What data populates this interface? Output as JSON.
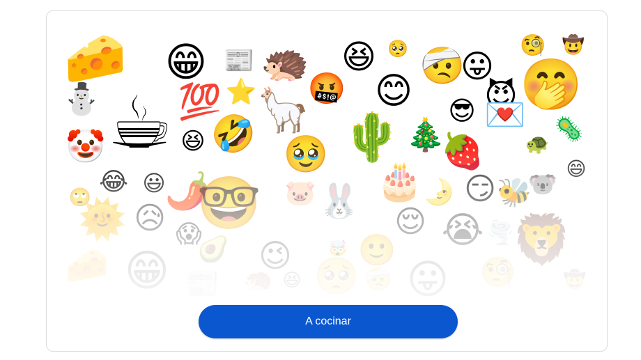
{
  "cta": {
    "label": "A cocinar",
    "color": "#0b57d0"
  },
  "emojis": [
    {
      "icon": "cheese-wedge-icon",
      "glyph": "🧀"
    },
    {
      "icon": "grinning-face-icon",
      "glyph": "😁"
    },
    {
      "icon": "newspaper-face-icon",
      "glyph": "📰"
    },
    {
      "icon": "hedgehog-icon",
      "glyph": "🦔"
    },
    {
      "icon": "laughing-face-icon",
      "glyph": "😆"
    },
    {
      "icon": "small-pleading-face-icon",
      "glyph": "🥺"
    },
    {
      "icon": "bandaged-face-icon",
      "glyph": "🤕"
    },
    {
      "icon": "tongue-face-icon",
      "glyph": "😛"
    },
    {
      "icon": "monocle-face-icon",
      "glyph": "🧐"
    },
    {
      "icon": "cowboy-face-icon",
      "glyph": "🤠"
    },
    {
      "icon": "hand-over-mouth-face-icon",
      "glyph": "🤭"
    },
    {
      "icon": "snowman-icon",
      "glyph": "⛄"
    },
    {
      "icon": "coffee-cup-icon",
      "glyph": "☕"
    },
    {
      "icon": "hundred-points-icon",
      "glyph": "💯"
    },
    {
      "icon": "star-face-icon",
      "glyph": "⭐"
    },
    {
      "icon": "llama-icon",
      "glyph": "🦙"
    },
    {
      "icon": "cursing-face-icon",
      "glyph": "🤬"
    },
    {
      "icon": "smiling-face-icon",
      "glyph": "😊"
    },
    {
      "icon": "devil-face-icon",
      "glyph": "😈"
    },
    {
      "icon": "sunglasses-face-icon",
      "glyph": "😎"
    },
    {
      "icon": "love-letter-icon",
      "glyph": "💌"
    },
    {
      "icon": "clown-face-icon",
      "glyph": "🤡"
    },
    {
      "icon": "squinting-face-icon",
      "glyph": "😆"
    },
    {
      "icon": "rolling-laughing-face-icon",
      "glyph": "🤣"
    },
    {
      "icon": "crying-face-icon",
      "glyph": "🥹"
    },
    {
      "icon": "cactus-icon",
      "glyph": "🌵"
    },
    {
      "icon": "christmas-tree-icon",
      "glyph": "🎄"
    },
    {
      "icon": "strawberry-icon",
      "glyph": "🍓"
    },
    {
      "icon": "turtle-icon",
      "glyph": "🐢"
    },
    {
      "icon": "microbe-icon",
      "glyph": "🦠"
    },
    {
      "icon": "tears-of-joy-face-icon",
      "glyph": "😂"
    },
    {
      "icon": "grinning-face-big-icon",
      "glyph": "😃"
    },
    {
      "icon": "hot-pepper-icon",
      "glyph": "🌶️"
    },
    {
      "icon": "glasses-face-icon",
      "glyph": "🤓"
    },
    {
      "icon": "birthday-cake-icon",
      "glyph": "🎂"
    },
    {
      "icon": "moon-face-icon",
      "glyph": "🌛"
    },
    {
      "icon": "smirk-face-icon",
      "glyph": "😏"
    },
    {
      "icon": "bee-icon",
      "glyph": "🐝"
    },
    {
      "icon": "koala-icon",
      "glyph": "🐨"
    },
    {
      "icon": "beaming-face-icon",
      "glyph": "😄"
    },
    {
      "icon": "rolling-eyes-face-icon",
      "glyph": "🙄"
    },
    {
      "icon": "sun-face-icon",
      "glyph": "🌞"
    },
    {
      "icon": "anxious-face-icon",
      "glyph": "😥"
    },
    {
      "icon": "fearful-face-icon",
      "glyph": "😱"
    },
    {
      "icon": "pig-face-icon",
      "glyph": "🐷"
    },
    {
      "icon": "rabbit-icon",
      "glyph": "🐰"
    },
    {
      "icon": "smiling-squint-face-icon",
      "glyph": "😌"
    },
    {
      "icon": "loudly-crying-face-icon",
      "glyph": "😭"
    },
    {
      "icon": "tornado-face-icon",
      "glyph": "🌪️"
    },
    {
      "icon": "lion-face-icon",
      "glyph": "🦁"
    },
    {
      "icon": "avocado-icon",
      "glyph": "🥑"
    },
    {
      "icon": "winking-face-icon",
      "glyph": "😉"
    },
    {
      "icon": "exploding-head-icon",
      "glyph": "🤯"
    },
    {
      "icon": "small-smiley-face-icon",
      "glyph": "🙂"
    }
  ]
}
